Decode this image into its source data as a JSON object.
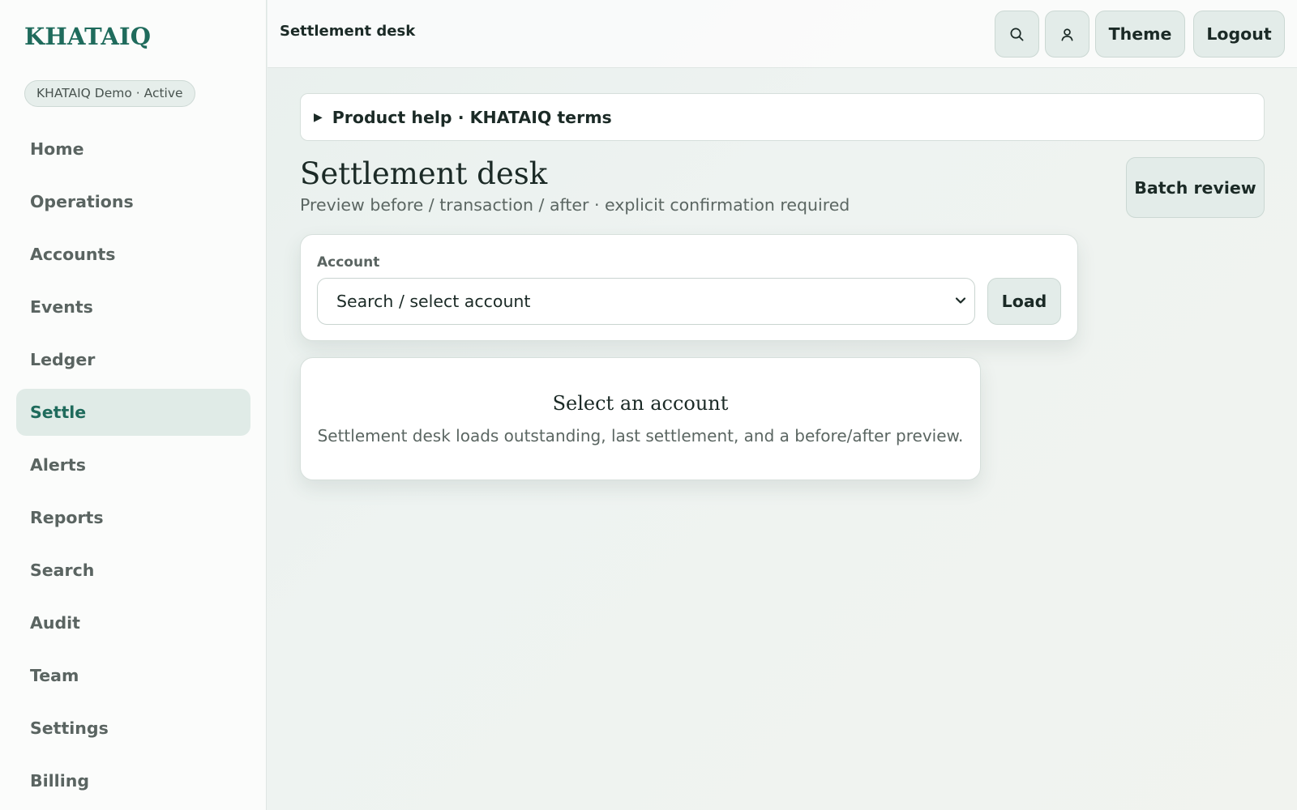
{
  "sidebar": {
    "brand": "KHATAIQ",
    "org_status": "KHATAIQ Demo · Active",
    "items": [
      {
        "label": "Home"
      },
      {
        "label": "Operations"
      },
      {
        "label": "Accounts"
      },
      {
        "label": "Events"
      },
      {
        "label": "Ledger"
      },
      {
        "label": "Settle",
        "active": true
      },
      {
        "label": "Alerts"
      },
      {
        "label": "Reports"
      },
      {
        "label": "Search"
      },
      {
        "label": "Audit"
      },
      {
        "label": "Team"
      },
      {
        "label": "Settings"
      },
      {
        "label": "Billing"
      }
    ]
  },
  "topbar": {
    "title": "Settlement desk",
    "search_icon": "search-icon",
    "user_icon": "user-icon",
    "theme_label": "Theme",
    "logout_label": "Logout"
  },
  "help": {
    "label": "Product help · KHATAIQ terms"
  },
  "main": {
    "title": "Settlement desk",
    "subtitle": "Preview before / transaction / after · explicit confirmation required",
    "batch_review_label": "Batch review",
    "account": {
      "label": "Account",
      "selected": "Search / select account",
      "load_label": "Load"
    },
    "empty_state": {
      "title": "Select an account",
      "description": "Settlement desk loads outstanding, last settlement, and a before/after preview."
    }
  },
  "colors": {
    "accent": "#1f6b5c",
    "active_nav_bg": "#e0ebe7",
    "button_bg": "#e3ece9"
  }
}
